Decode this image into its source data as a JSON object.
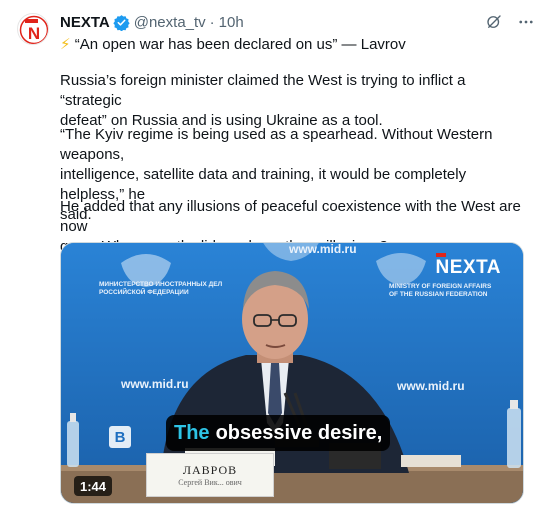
{
  "author": {
    "name": "NEXTA",
    "handle": "@nexta_tv",
    "separator": "·",
    "time": "10h",
    "verified": true,
    "avatar_icon": "nexta-logo-icon"
  },
  "header_icons": [
    "grok-icon",
    "more-icon"
  ],
  "tweet": {
    "emoji": "⚡",
    "quote_line": "“An open war has been declared on us” — Lavrov",
    "paragraph_1_line_1": "Russia’s foreign minister claimed the West is trying to inflict a “strategic",
    "paragraph_1_line_2": "defeat” on Russia and is using Ukraine as a tool.",
    "paragraph_2_line_1": "“The Kyiv regime is being used as a spearhead. Without Western weapons,",
    "paragraph_2_line_2": "intelligence, satellite data and training, it would be completely helpless,” he",
    "paragraph_2_line_3": "said.",
    "paragraph_3_line_1": "He added that any illusions of peaceful coexistence with the West are now",
    "paragraph_3_line_2": "gone. When exactly did you have those illusions?"
  },
  "video": {
    "watermark": "NEXTA",
    "caption_highlight": "The",
    "caption_rest": "obsessive desire,",
    "duration": "1:44",
    "channel_badge": "B",
    "nameplate_name": "ЛАВРОВ",
    "nameplate_sub": "Сергей Вик... ович",
    "wall_url_left": "www.mid.ru",
    "wall_url_right": "www.mid.ru",
    "wall_url_top": "www.mid.ru",
    "wall_org_left_1": "МИНИСТЕРСТВО ИНОСТРАННЫХ ДЕЛ",
    "wall_org_left_2": "РОССИЙСКОЙ ФЕДЕРАЦИИ",
    "wall_org_right_1": "MINISTRY OF FOREIGN AFFAIRS",
    "wall_org_right_2": "OF THE RUSSIAN FEDERATION"
  },
  "colors": {
    "name": "#0f1419",
    "secondary": "#536471",
    "verified": "#1d9bf0",
    "backdrop": "#1f6fc0",
    "caption_highlight": "#2ec4e6",
    "brand_red": "#e0241b"
  }
}
